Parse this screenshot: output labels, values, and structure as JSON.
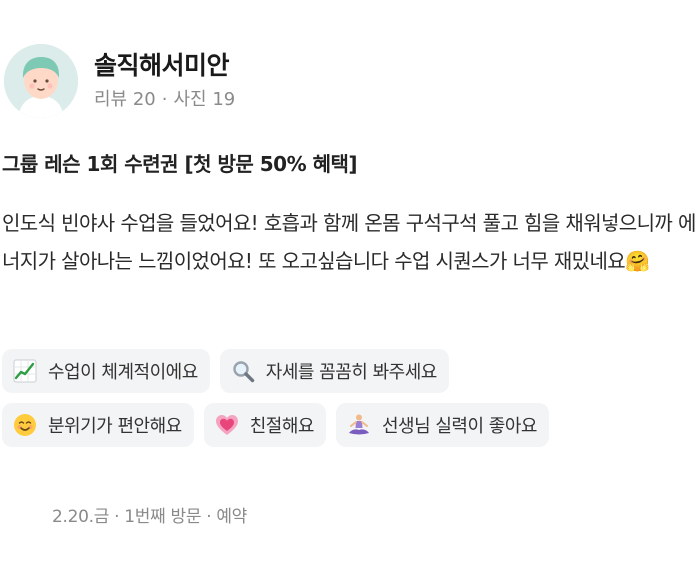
{
  "review": {
    "author": {
      "nickname": "솔직해서미안",
      "review_count_label": "리뷰 20",
      "photo_count_label": "사진 19"
    },
    "product_name": "그룹 레슨 1회 수련권 [첫 방문 50% 혜택]",
    "body_text": "인도식 빈야사 수업을 들었어요! 호흡과 함께 온몸 구석구석 풀고 힘을 채워넣으니까 에너지가 살아나는 느낌이었어요! 또 오고싶습니다 수업 시퀀스가 너무 재밌네요🤗",
    "keyword_tags": [
      {
        "icon": "chart-up-icon",
        "label": "수업이 체계적이에요"
      },
      {
        "icon": "magnifier-icon",
        "label": "자세를 꼼꼼히 봐주세요"
      },
      {
        "icon": "smiling-face-icon",
        "label": "분위기가 편안해요"
      },
      {
        "icon": "growing-heart-icon",
        "label": "친절해요"
      },
      {
        "icon": "meditation-icon",
        "label": "선생님 실력이 좋아요"
      }
    ],
    "footer": {
      "visit_date": "2.20.금",
      "visit_count": "1번째 방문",
      "visit_type": "예약"
    }
  }
}
